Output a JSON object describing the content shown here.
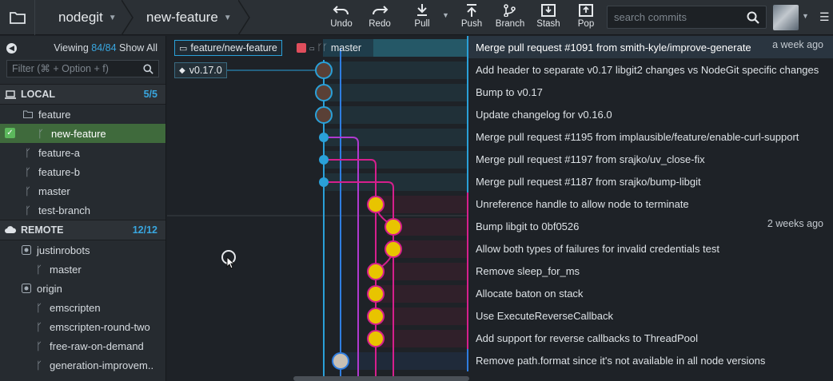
{
  "toolbar": {
    "repo": "nodegit",
    "branch": "new-feature",
    "actions": [
      {
        "label": "Undo",
        "icon": "undo-icon"
      },
      {
        "label": "Redo",
        "icon": "redo-icon"
      },
      {
        "label": "Pull",
        "icon": "pull-icon"
      },
      {
        "label": "Push",
        "icon": "push-icon"
      },
      {
        "label": "Branch",
        "icon": "branch-icon"
      },
      {
        "label": "Stash",
        "icon": "stash-icon"
      },
      {
        "label": "Pop",
        "icon": "pop-icon"
      }
    ],
    "search_placeholder": "search commits"
  },
  "sidebar": {
    "viewing_label": "Viewing",
    "viewing_count": "84/84",
    "show_all": "Show All",
    "filter_placeholder": "Filter (⌘ + Option + f)",
    "local": {
      "title": "LOCAL",
      "count": "5/5",
      "folder": "feature",
      "items": [
        "new-feature",
        "feature-a",
        "feature-b",
        "master",
        "test-branch"
      ]
    },
    "remote": {
      "title": "REMOTE",
      "count": "12/12",
      "remotes": [
        {
          "name": "justinrobots",
          "branches": [
            "master"
          ]
        },
        {
          "name": "origin",
          "branches": [
            "emscripten",
            "emscripten-round-two",
            "free-raw-on-demand",
            "generation-improvem.."
          ]
        }
      ]
    }
  },
  "refs": {
    "head_branch": "feature/new-feature",
    "master": "master",
    "tag": "v0.17.0"
  },
  "commits": [
    {
      "message": "Merge pull request #1091 from smith-kyle/improve-generate",
      "when": "a week ago"
    },
    {
      "message": "Add header to separate v0.17 libgit2 changes vs NodeGit specific changes",
      "when": ""
    },
    {
      "message": "Bump to v0.17",
      "when": ""
    },
    {
      "message": "Update changelog for v0.16.0",
      "when": ""
    },
    {
      "message": "Merge pull request #1195 from implausible/feature/enable-curl-support",
      "when": ""
    },
    {
      "message": "Merge pull request #1197 from srajko/uv_close-fix",
      "when": ""
    },
    {
      "message": "Merge pull request #1187 from srajko/bump-libgit",
      "when": ""
    },
    {
      "message": "Unreference handle to allow node to terminate",
      "when": ""
    },
    {
      "message": "Bump libgit to 0bf0526",
      "when": "2 weeks ago"
    },
    {
      "message": "Allow both types of failures for invalid credentials test",
      "when": ""
    },
    {
      "message": "Remove sleep_for_ms",
      "when": ""
    },
    {
      "message": "Allocate baton on stack",
      "when": ""
    },
    {
      "message": "Use ExecuteReverseCallback",
      "when": ""
    },
    {
      "message": "Add support for reverse callbacks to ThreadPool",
      "when": ""
    },
    {
      "message": "Remove path.format since it's not available in all node versions",
      "when": ""
    }
  ],
  "colors": {
    "cyan": "#2aa0d8",
    "magenta": "#d61f8d",
    "purple": "#b03ad0",
    "blue": "#2f7de0",
    "selected_green": "#3f6a3c"
  }
}
